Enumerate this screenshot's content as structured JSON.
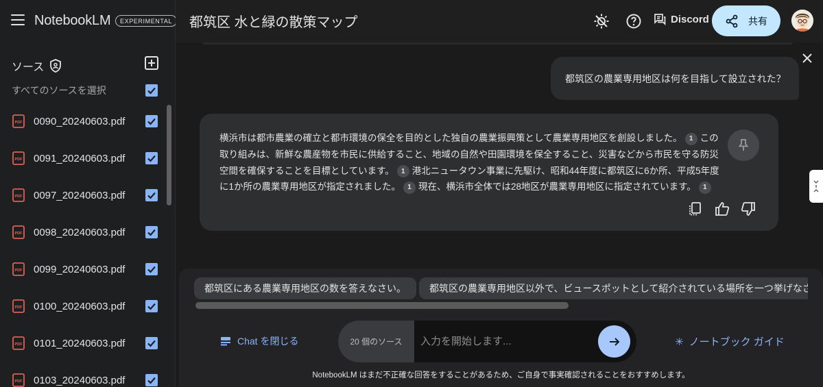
{
  "app": {
    "brand": "NotebookLM",
    "badge": "EXPERIMENTAL",
    "notebook_title": "都筑区 水と緑の散策マップ"
  },
  "header": {
    "discord_label": "Discord",
    "share_label": "共有",
    "icons": [
      "theme-icon",
      "help-icon",
      "feedback-icon",
      "share-icon"
    ]
  },
  "sidebar": {
    "sources_heading": "ソース",
    "select_all_label": "すべてのソースを選択",
    "sources": [
      {
        "name": "0090_20240603.pdf",
        "checked": true
      },
      {
        "name": "0091_20240603.pdf",
        "checked": true
      },
      {
        "name": "0097_20240603.pdf",
        "checked": true
      },
      {
        "name": "0098_20240603.pdf",
        "checked": true
      },
      {
        "name": "0099_20240603.pdf",
        "checked": true
      },
      {
        "name": "0100_20240603.pdf",
        "checked": true
      },
      {
        "name": "0101_20240603.pdf",
        "checked": true
      },
      {
        "name": "0103_20240603.pdf",
        "checked": true
      }
    ]
  },
  "chat": {
    "user_question": "都筑区の農業専用地区は何を目指して設立された？",
    "answer_segments": [
      {
        "text": "横浜市は都市農業の確立と都市環境の保全を目的とした独自の農業振興策として農業専用地区を創設しました。",
        "cite": "1"
      },
      {
        "text": "この取り組みは、新鮮な農産物を市民に供給すること、地域の自然や田園環境を保全すること、災害などから市民を守る防災空間を確保することを目標としています。",
        "cite": "1"
      },
      {
        "text": "港北ニュータウン事業に先駆け、昭和44年度に都筑区に6か所、平成5年度に1か所の農業専用地区が指定されました。",
        "cite": "1"
      },
      {
        "text": "現在、横浜市全体では28地区が農業専用地区に指定されています。",
        "cite": "1"
      }
    ],
    "suggestions": [
      "都筑区にある農業専用地区の数を答えなさい。",
      "都筑区の農業専用地区以外で、ビュースポットとして紹介されている場所を一つ挙げなさい。"
    ]
  },
  "composer": {
    "close_chat_label": "Chat を閉じる",
    "source_count_label": "20 個のソース",
    "input_placeholder": "入力を開始します...",
    "input_value": "",
    "guide_label": "ノートブック ガイド",
    "disclaimer": "NotebookLM はまだ不正確な回答をすることがあるため、ご自身で事実確認されることをおすすめします。"
  },
  "colors": {
    "accent": "#8ab4f8",
    "share_bg": "#c2e7ff",
    "pdf_icon": "#e06055",
    "send_bg": "#a8c7fa"
  }
}
